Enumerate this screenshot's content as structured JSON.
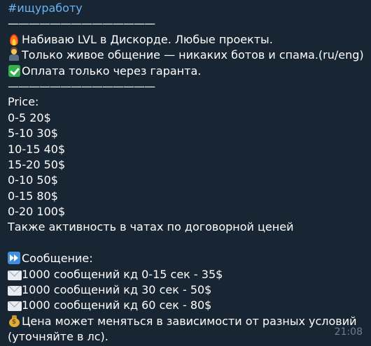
{
  "message": {
    "hashtag": "#ищуработу",
    "divider": "——————————————",
    "intro": [
      {
        "icon": "fire-icon",
        "text": "Набиваю LVL в Дискорде. Любые проекты."
      },
      {
        "icon": "person-icon",
        "text": "Только живое общение — никаких ботов и спама.(ru/eng)"
      },
      {
        "icon": "check-mark-icon",
        "text": "Оплата только через гаранта."
      }
    ],
    "price_heading": "Price:",
    "prices": [
      "0-5 20$",
      "5-10 30$",
      "10-15 40$",
      "15-20 50$",
      "0-10 50$",
      "0-15 80$",
      "0-20 100$"
    ],
    "chat_activity_note": "Также активность в чатах по договорной ценей",
    "messages_heading": "Сообщение:",
    "message_offers": [
      "1000 сообщений кд 0-15 сек - 35$",
      "1000 сообщений кд 30 сек - 50$",
      "1000 сообщений кд 60 сек - 80$"
    ],
    "price_note_line1": "Цена может меняться в зависимости от разных условий",
    "price_note_line2": "(уточняйте в лс).",
    "timestamp": "21:08"
  },
  "colors": {
    "background": "#182533",
    "text": "#ffffff",
    "hashtag": "#6ab3f3",
    "timestamp": "#6d7f8f"
  }
}
